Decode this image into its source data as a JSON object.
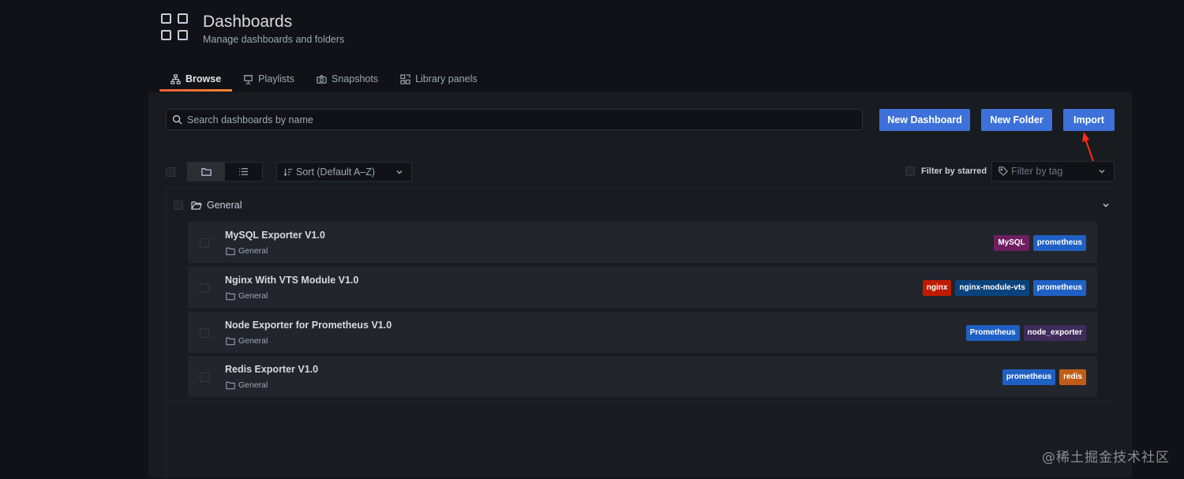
{
  "header": {
    "title": "Dashboards",
    "subtitle": "Manage dashboards and folders"
  },
  "tabs": [
    {
      "label": "Browse",
      "icon": "sitemap-icon",
      "active": true
    },
    {
      "label": "Playlists",
      "icon": "presentation-icon"
    },
    {
      "label": "Snapshots",
      "icon": "camera-icon"
    },
    {
      "label": "Library panels",
      "icon": "library-panel-icon"
    }
  ],
  "search": {
    "placeholder": "Search dashboards by name",
    "value": ""
  },
  "buttons": {
    "new_dashboard": "New Dashboard",
    "new_folder": "New Folder",
    "import": "Import"
  },
  "toolbar": {
    "sort_label": "Sort (Default A–Z)",
    "filter_starred": "Filter by starred",
    "filter_tag_placeholder": "Filter by tag"
  },
  "folder": {
    "name": "General"
  },
  "dashboards": [
    {
      "title": "MySQL Exporter V1.0",
      "folder": "General",
      "tags": [
        {
          "label": "MySQL",
          "color": "#6d1f62"
        },
        {
          "label": "prometheus",
          "color": "#1f60c4"
        }
      ]
    },
    {
      "title": "Nginx With VTS Module V1.0",
      "folder": "General",
      "tags": [
        {
          "label": "nginx",
          "color": "#bf1b00"
        },
        {
          "label": "nginx-module-vts",
          "color": "#0a437c"
        },
        {
          "label": "prometheus",
          "color": "#1f60c4"
        }
      ]
    },
    {
      "title": "Node Exporter for Prometheus V1.0",
      "folder": "General",
      "tags": [
        {
          "label": "Prometheus",
          "color": "#1f60c4"
        },
        {
          "label": "node_exporter",
          "color": "#3f2b5b"
        }
      ]
    },
    {
      "title": "Redis Exporter V1.0",
      "folder": "General",
      "tags": [
        {
          "label": "prometheus",
          "color": "#1f60c4"
        },
        {
          "label": "redis",
          "color": "#c15c17"
        }
      ]
    }
  ],
  "watermark": "@稀土掘金技术社区",
  "colors": {
    "background": "#111217",
    "panel": "#181b1f",
    "row": "#22252b",
    "primary": "#3d71d9",
    "active_tab": "#f55f3e",
    "annotation_arrow": "#ff2a1a"
  }
}
